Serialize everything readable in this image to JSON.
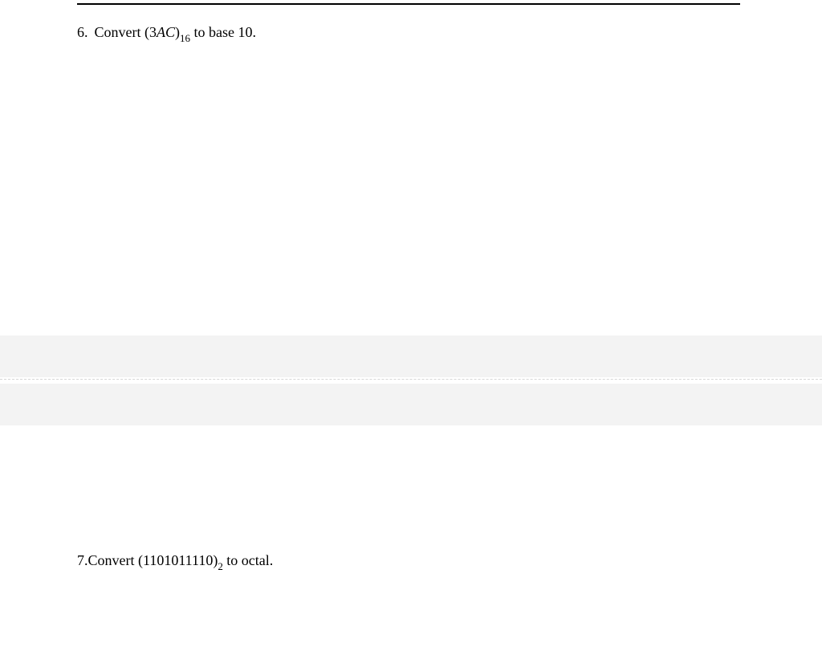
{
  "questions": {
    "q6": {
      "number": "6.",
      "text_before": "Convert (3",
      "italic_part": "AC",
      "paren_close": ")",
      "subscript": "16",
      "text_after": " to base 10."
    },
    "q7": {
      "number": "7.",
      "text_before": "Convert  (1101011110)",
      "subscript": "2",
      "text_after": " to octal."
    }
  }
}
